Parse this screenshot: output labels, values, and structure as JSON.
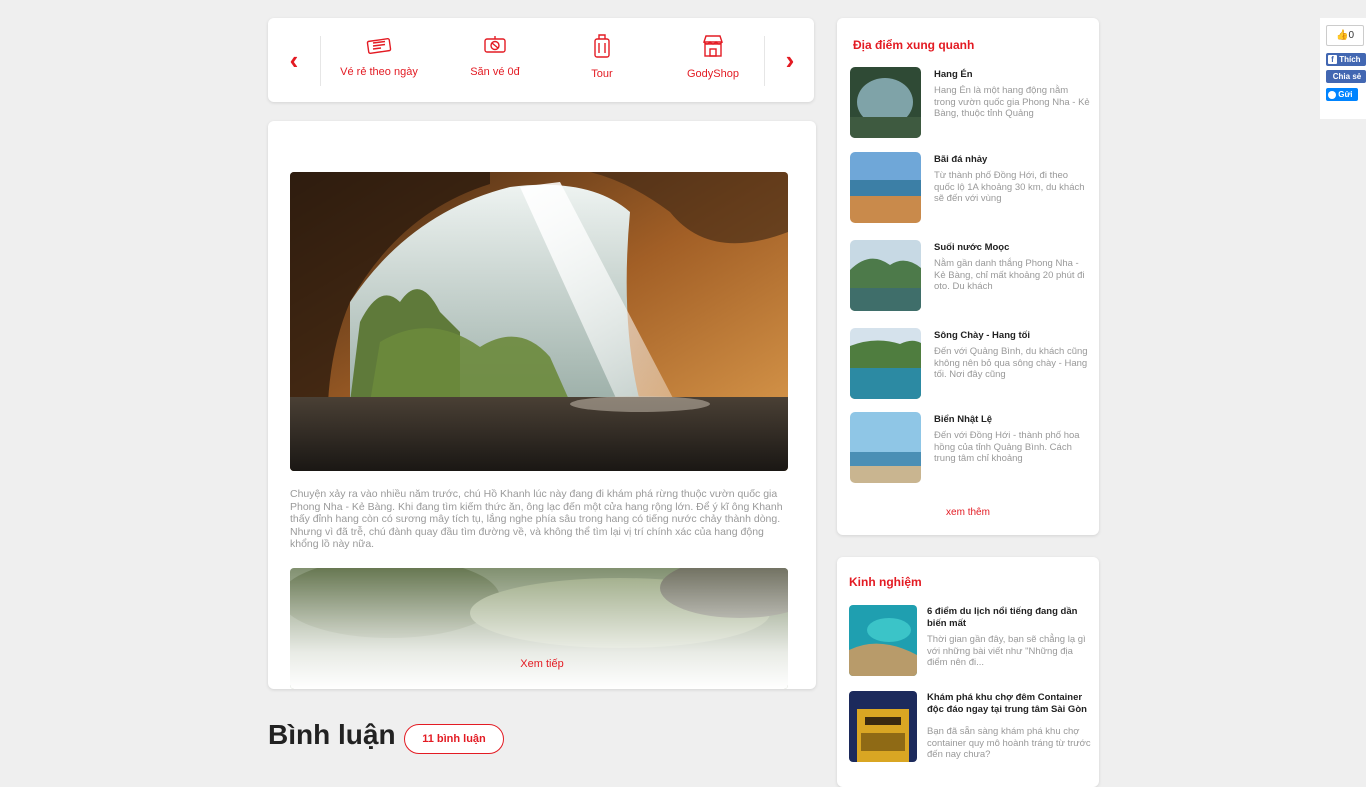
{
  "nav": {
    "items": [
      {
        "label": "Vé rẻ theo ngày",
        "icon": "ticket-icon"
      },
      {
        "label": "Săn vé 0đ",
        "icon": "ticket-hunt-icon"
      },
      {
        "label": "Tour",
        "icon": "luggage-icon"
      },
      {
        "label": "GodyShop",
        "icon": "shop-icon"
      }
    ]
  },
  "article": {
    "paragraph": "Chuyện xảy ra vào nhiều năm trước, chú Hồ Khanh lúc này đang đi khám phá rừng thuộc vườn quốc gia Phong Nha - Kẻ Bàng. Khi đang tìm kiếm thức ăn, ông lạc đến một cửa hang rộng lớn. Để ý kĩ ông Khanh thấy đỉnh hang còn có sương mây tích tụ, lắng nghe phía sâu trong hang có tiếng nước chảy thành dòng. Nhưng vì đã trễ, chú đành quay đầu tìm đường về, và không thể tìm lại vị trí chính xác của hang động khổng lồ này nữa.",
    "read_more": "Xem tiếp"
  },
  "comments": {
    "title": "Bình luận",
    "count_label": "11 bình luận"
  },
  "nearby": {
    "title": "Địa điểm xung quanh",
    "items": [
      {
        "name": "Hang Én",
        "desc": "Hang Én là một hang động nằm trong vườn quốc gia Phong Nha - Kẻ Bàng, thuộc tỉnh Quảng"
      },
      {
        "name": "Bãi đá nhảy",
        "desc": "Từ thành phố Đồng Hới, đi theo quốc lộ 1A khoảng 30 km, du khách sẽ đến với vùng"
      },
      {
        "name": "Suối nước Moọc",
        "desc": "Nằm gần danh thắng Phong Nha - Kẻ Bàng, chỉ mất khoảng 20 phút đi oto. Du khách"
      },
      {
        "name": "Sông Chày - Hang tối",
        "desc": "Đến với Quảng Bình, du khách cũng không nên bỏ qua sông chày - Hang tối. Nơi đây cũng"
      },
      {
        "name": "Biển Nhật Lệ",
        "desc": "Đến với Đồng Hới - thành phố hoa hồng của tỉnh Quảng Bình. Cách trung tâm chỉ khoảng"
      }
    ],
    "see_more": "xem thêm"
  },
  "experience": {
    "title": "Kinh nghiệm",
    "items": [
      {
        "name": "6 điểm du lịch nổi tiếng đang dần biến mất",
        "desc": "Thời gian gần đây, bạn sẽ chẳng lạ gì với những bài viết như \"Những địa điểm nên đi..."
      },
      {
        "name": "Khám phá khu chợ đêm Container độc đáo ngay tại trung tâm Sài Gòn",
        "desc": "Bạn đã sẵn sàng khám phá khu chợ container quy mô hoành tráng từ trước đến nay chưa?"
      }
    ]
  },
  "social": {
    "like_count": "0",
    "like_label": "Thích",
    "share_label": "Chia sẻ",
    "send_label": "Gửi"
  },
  "colors": {
    "accent": "#e31b23",
    "background": "#efefef",
    "facebook": "#4267b2",
    "messenger": "#0084ff"
  }
}
